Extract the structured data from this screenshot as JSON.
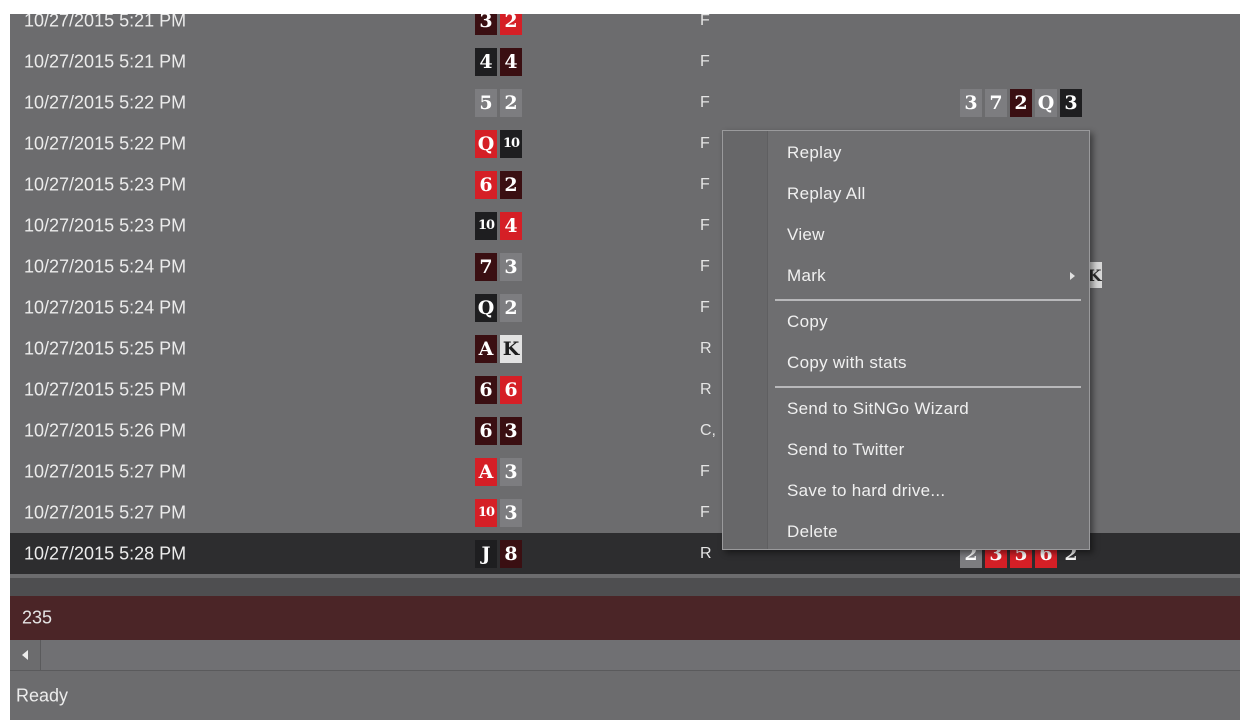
{
  "rows": [
    {
      "date": "10/27/2015 5:21 PM",
      "action": "F",
      "hole": [
        {
          "rank": "3",
          "style": "d"
        },
        {
          "rank": "2",
          "style": "r"
        }
      ]
    },
    {
      "date": "10/27/2015 5:21 PM",
      "action": "F",
      "hole": [
        {
          "rank": "4",
          "style": "k"
        },
        {
          "rank": "4",
          "style": "d"
        }
      ]
    },
    {
      "date": "10/27/2015 5:22 PM",
      "action": "F",
      "hole": [
        {
          "rank": "5",
          "style": "g"
        },
        {
          "rank": "2",
          "style": "g"
        }
      ],
      "board": [
        {
          "rank": "3",
          "style": "g"
        },
        {
          "rank": "7",
          "style": "g"
        },
        {
          "rank": "2",
          "style": "d"
        },
        {
          "rank": "Q",
          "style": "g"
        },
        {
          "rank": "3",
          "style": "k"
        }
      ]
    },
    {
      "date": "10/27/2015 5:22 PM",
      "action": "F",
      "hole": [
        {
          "rank": "Q",
          "style": "r"
        },
        {
          "rank": "10",
          "style": "k"
        }
      ]
    },
    {
      "date": "10/27/2015 5:23 PM",
      "action": "F",
      "hole": [
        {
          "rank": "6",
          "style": "r"
        },
        {
          "rank": "2",
          "style": "d"
        }
      ]
    },
    {
      "date": "10/27/2015 5:23 PM",
      "action": "F",
      "hole": [
        {
          "rank": "10",
          "style": "k"
        },
        {
          "rank": "4",
          "style": "r"
        }
      ]
    },
    {
      "date": "10/27/2015 5:24 PM",
      "action": "F",
      "hole": [
        {
          "rank": "7",
          "style": "d"
        },
        {
          "rank": "3",
          "style": "g"
        }
      ]
    },
    {
      "date": "10/27/2015 5:24 PM",
      "action": "F",
      "hole": [
        {
          "rank": "Q",
          "style": "k"
        },
        {
          "rank": "2",
          "style": "g"
        }
      ]
    },
    {
      "date": "10/27/2015 5:25 PM",
      "action": "R",
      "hole": [
        {
          "rank": "A",
          "style": "d"
        },
        {
          "rank": "K",
          "style": "w"
        }
      ]
    },
    {
      "date": "10/27/2015 5:25 PM",
      "action": "R",
      "hole": [
        {
          "rank": "6",
          "style": "d"
        },
        {
          "rank": "6",
          "style": "r"
        }
      ]
    },
    {
      "date": "10/27/2015 5:26 PM",
      "action": "C,",
      "hole": [
        {
          "rank": "6",
          "style": "d"
        },
        {
          "rank": "3",
          "style": "d"
        }
      ]
    },
    {
      "date": "10/27/2015 5:27 PM",
      "action": "F",
      "hole": [
        {
          "rank": "A",
          "style": "r"
        },
        {
          "rank": "3",
          "style": "g"
        }
      ]
    },
    {
      "date": "10/27/2015 5:27 PM",
      "action": "F",
      "hole": [
        {
          "rank": "10",
          "style": "r"
        },
        {
          "rank": "3",
          "style": "g"
        }
      ]
    },
    {
      "date": "10/27/2015 5:28 PM",
      "action": "R",
      "selected": true,
      "hole": [
        {
          "rank": "J",
          "style": "k"
        },
        {
          "rank": "8",
          "style": "d"
        }
      ],
      "board": [
        {
          "rank": "2",
          "style": "g"
        },
        {
          "rank": "3",
          "style": "r"
        },
        {
          "rank": "5",
          "style": "r"
        },
        {
          "rank": "6",
          "style": "r"
        },
        {
          "rank": "2",
          "style": "n"
        }
      ]
    }
  ],
  "partial_card": {
    "rank": "K"
  },
  "total": "235",
  "status": "Ready",
  "context_menu": {
    "items": [
      {
        "label": "Replay"
      },
      {
        "label": "Replay All"
      },
      {
        "label": "View"
      },
      {
        "label": "Mark",
        "submenu": true
      },
      {
        "separator": true
      },
      {
        "label": "Copy"
      },
      {
        "label": "Copy with stats"
      },
      {
        "separator": true
      },
      {
        "label": "Send to SitNGo Wizard"
      },
      {
        "label": "Send to Twitter"
      },
      {
        "label": "Save to hard drive..."
      },
      {
        "label": "Delete"
      }
    ]
  },
  "colors": {
    "red_card": "#d51f26",
    "dark_card": "#3a0f12",
    "black_card": "#1e1e20",
    "gray_card": "#7d7d80",
    "total_bar": "#4b2527"
  }
}
